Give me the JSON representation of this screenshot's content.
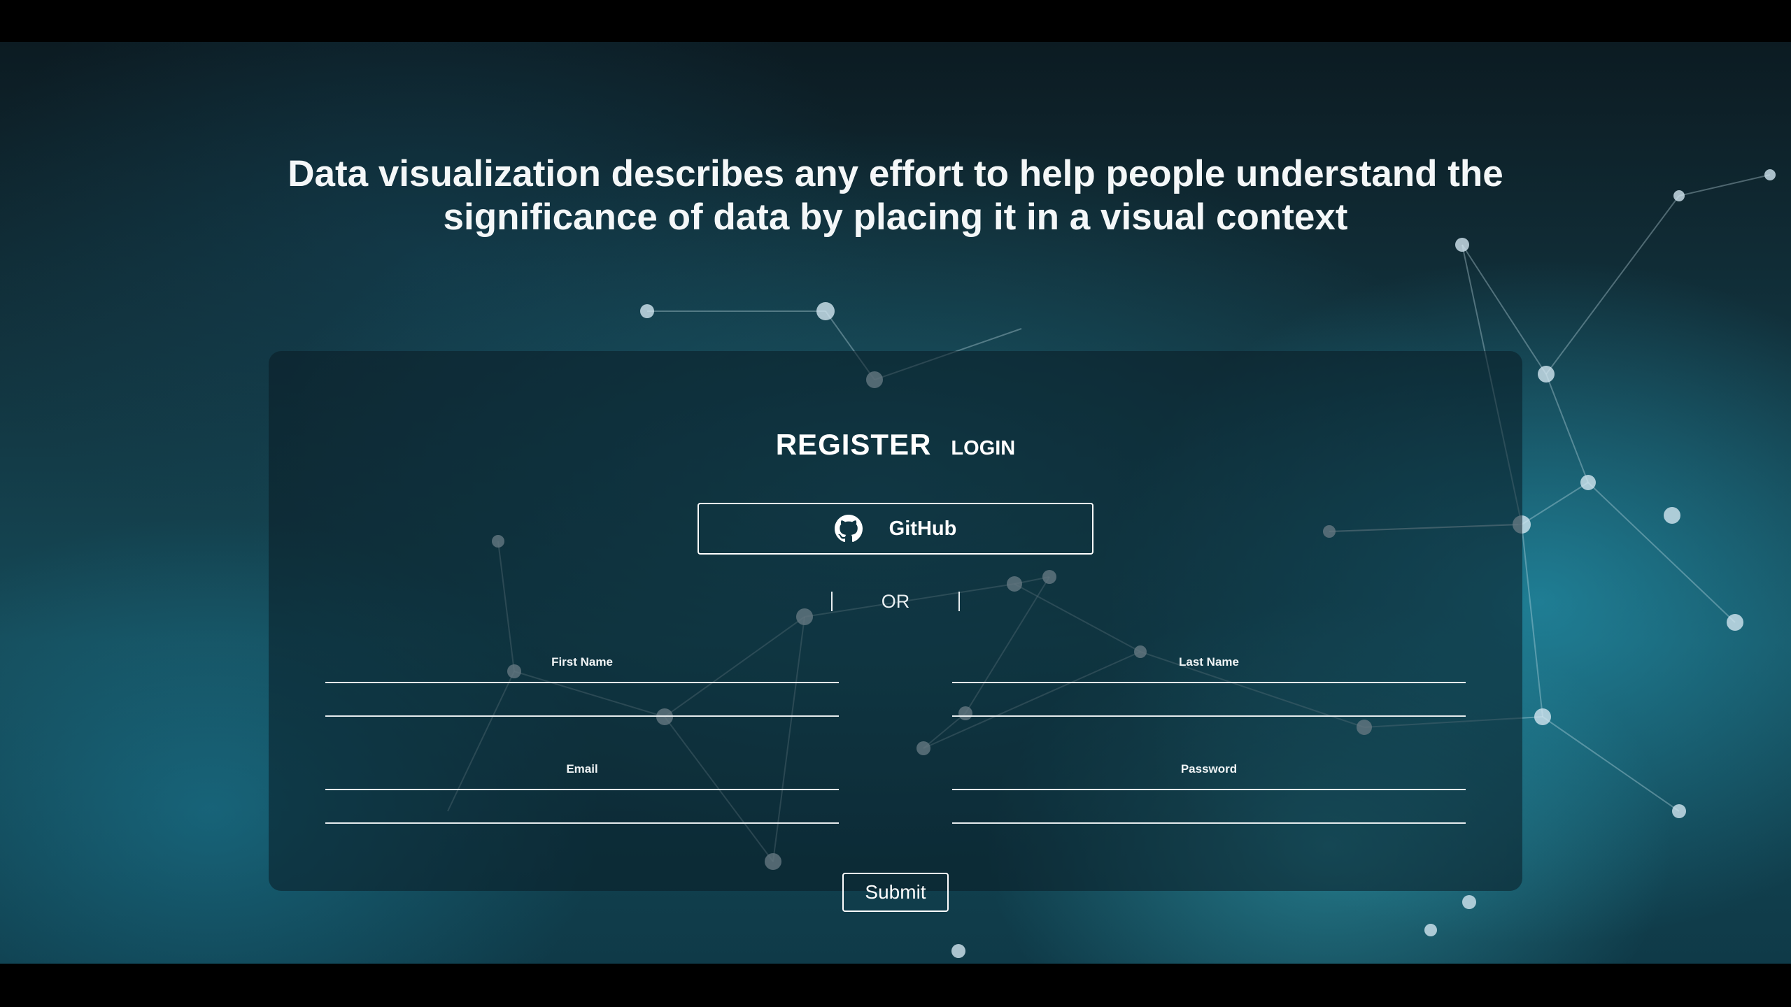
{
  "headline": "Data visualization describes any effort to help people understand the significance of data by placing it in a visual context",
  "tabs": {
    "register": "REGISTER",
    "login": "LOGIN"
  },
  "oauth": {
    "github_label": "GitHub",
    "github_icon": "github-icon"
  },
  "divider": {
    "text": "OR"
  },
  "form": {
    "first_name": {
      "label": "First Name",
      "value": "",
      "placeholder": ""
    },
    "last_name": {
      "label": "Last Name",
      "value": "",
      "placeholder": ""
    },
    "email": {
      "label": "Email",
      "value": "",
      "placeholder": ""
    },
    "password": {
      "label": "Password",
      "value": "",
      "placeholder": ""
    },
    "submit_label": "Submit"
  },
  "colors": {
    "text": "#ffffff",
    "panel": "#0a1c24",
    "accent": "#3fb8d0"
  }
}
